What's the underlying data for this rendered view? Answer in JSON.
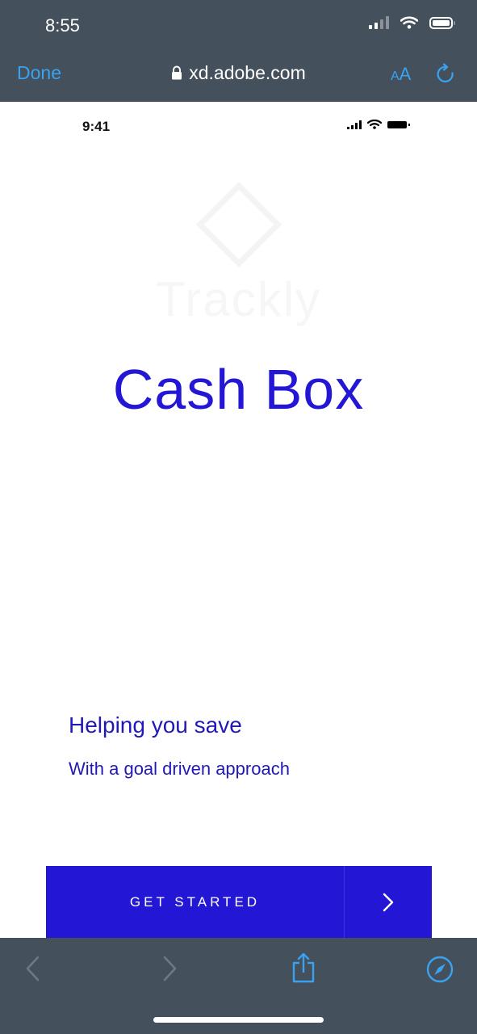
{
  "system": {
    "time": "8:55"
  },
  "browser": {
    "done_label": "Done",
    "url": "xd.adobe.com",
    "text_size_label_small": "A",
    "text_size_label_large": "A",
    "icons": {
      "lock": "lock-icon",
      "reload": "reload-icon",
      "back": "chevron-left-icon",
      "forward": "chevron-right-icon",
      "share": "share-icon",
      "safari": "compass-icon"
    },
    "colors": {
      "chrome": "#44505c",
      "accent": "#3aa2ef"
    }
  },
  "app": {
    "status_time": "9:41",
    "watermark_text": "Trackly",
    "brand_title": "Cash Box",
    "headline": "Helping you save",
    "subheadline": "With a goal driven approach",
    "cta_label": "GET STARTED",
    "cta_arrow_icon": "chevron-right-icon",
    "colors": {
      "primary": "#2316d4",
      "text": "#2218b8"
    }
  }
}
